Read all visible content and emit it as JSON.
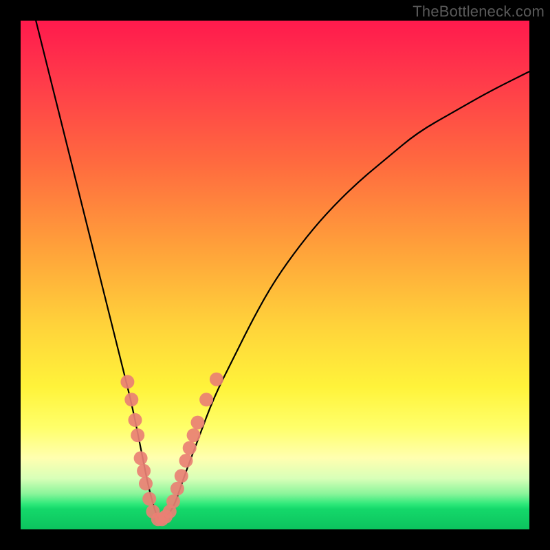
{
  "watermark": "TheBottleneck.com",
  "chart_data": {
    "type": "line",
    "title": "",
    "xlabel": "",
    "ylabel": "",
    "xlim": [
      0,
      100
    ],
    "ylim": [
      0,
      100
    ],
    "grid": false,
    "series": [
      {
        "name": "bottleneck-curve",
        "x": [
          3,
          6,
          9,
          12,
          15,
          18,
          20,
          22,
          24,
          25,
          26,
          27,
          28,
          30,
          32,
          35,
          38,
          42,
          46,
          50,
          55,
          60,
          66,
          72,
          78,
          85,
          92,
          100
        ],
        "y": [
          100,
          88,
          76,
          64,
          52,
          40,
          32,
          24,
          14,
          9,
          5,
          2,
          2,
          4,
          10,
          18,
          26,
          34,
          42,
          49,
          56,
          62,
          68,
          73,
          78,
          82,
          86,
          90
        ]
      }
    ],
    "markers": {
      "name": "highlighted-points",
      "color": "#e98074",
      "points": [
        {
          "x": 21.0,
          "y": 29.0
        },
        {
          "x": 21.8,
          "y": 25.5
        },
        {
          "x": 22.5,
          "y": 21.5
        },
        {
          "x": 23.0,
          "y": 18.5
        },
        {
          "x": 23.6,
          "y": 14.0
        },
        {
          "x": 24.2,
          "y": 11.5
        },
        {
          "x": 24.6,
          "y": 9.0
        },
        {
          "x": 25.3,
          "y": 6.0
        },
        {
          "x": 26.0,
          "y": 3.5
        },
        {
          "x": 27.0,
          "y": 2.0
        },
        {
          "x": 27.8,
          "y": 2.0
        },
        {
          "x": 28.5,
          "y": 2.5
        },
        {
          "x": 29.3,
          "y": 3.5
        },
        {
          "x": 30.0,
          "y": 5.5
        },
        {
          "x": 30.8,
          "y": 8.0
        },
        {
          "x": 31.6,
          "y": 10.5
        },
        {
          "x": 32.5,
          "y": 13.5
        },
        {
          "x": 33.2,
          "y": 16.0
        },
        {
          "x": 34.0,
          "y": 18.5
        },
        {
          "x": 34.8,
          "y": 21.0
        },
        {
          "x": 36.5,
          "y": 25.5
        },
        {
          "x": 38.5,
          "y": 29.5
        }
      ]
    },
    "annotations": []
  }
}
